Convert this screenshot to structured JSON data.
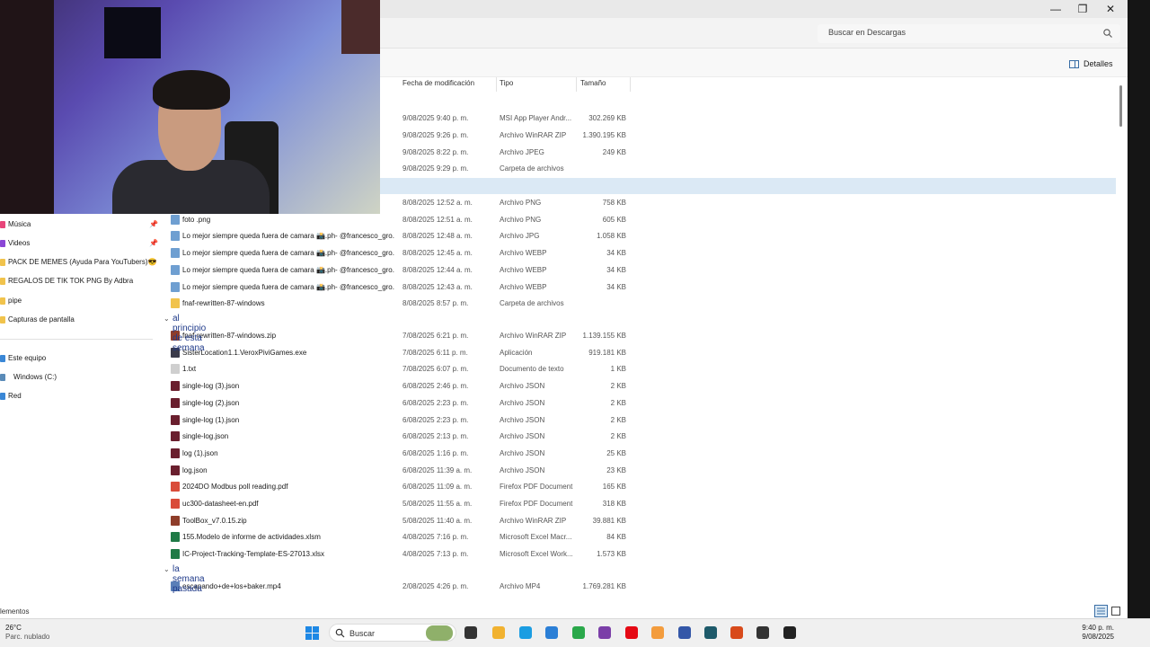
{
  "window": {
    "minimize": "—",
    "maximize": "❐",
    "close": "✕"
  },
  "search": {
    "placeholder": "Buscar en Descargas"
  },
  "toolbar": {
    "details_label": "Detalles"
  },
  "columns": {
    "date": "Fecha de modificación",
    "type": "Tipo",
    "size": "Tamaño"
  },
  "sidebar": {
    "items": [
      {
        "label": "Música",
        "pinned": true,
        "icon": "music-icon"
      },
      {
        "label": "Videos",
        "pinned": true,
        "icon": "video-icon"
      },
      {
        "label": "PACK DE MEMES (Ayuda Para YouTubers)😎",
        "pinned": false,
        "icon": "folder-icon"
      },
      {
        "label": "REGALOS DE TIK TOK PNG By Adbra",
        "pinned": false,
        "icon": "folder-icon"
      },
      {
        "label": "pipe",
        "pinned": false,
        "icon": "folder-icon"
      },
      {
        "label": "Capturas de pantalla",
        "pinned": false,
        "icon": "folder-icon"
      }
    ],
    "locations": [
      {
        "label": "Este equipo",
        "icon": "computer-icon"
      },
      {
        "label": "Windows (C:)",
        "icon": "drive-icon"
      },
      {
        "label": "Red",
        "icon": "network-icon"
      }
    ]
  },
  "files_top": [
    {
      "name": "",
      "date": "9/08/2025 9:40 p. m.",
      "type": "MSI App Player Andr...",
      "size": "302.269 KB"
    },
    {
      "name": "",
      "date": "9/08/2025 9:26 p. m.",
      "type": "Archivo WinRAR ZIP",
      "size": "1.390.195 KB"
    },
    {
      "name": "",
      "date": "9/08/2025 8:22 p. m.",
      "type": "Archivo JPEG",
      "size": "249 KB"
    },
    {
      "name": "",
      "date": "9/08/2025 9:29 p. m.",
      "type": "Carpeta de archivos",
      "size": ""
    },
    {
      "name": "",
      "date": "",
      "type": "",
      "size": ""
    },
    {
      "name": "",
      "date": "8/08/2025 12:52 a. m.",
      "type": "Archivo PNG",
      "size": "758 KB"
    },
    {
      "name": "foto .png",
      "date": "8/08/2025 12:51 a. m.",
      "type": "Archivo PNG",
      "size": "605 KB"
    },
    {
      "name": "Lo mejor siempre queda fuera de camara 📸.ph- @francesco_gro...",
      "date": "8/08/2025 12:48 a. m.",
      "type": "Archivo JPG",
      "size": "1.058 KB"
    },
    {
      "name": "Lo mejor siempre queda fuera de camara 📸.ph- @francesco_gro...",
      "date": "8/08/2025 12:45 a. m.",
      "type": "Archivo WEBP",
      "size": "34 KB"
    },
    {
      "name": "Lo mejor siempre queda fuera de camara 📸.ph- @francesco_gro...",
      "date": "8/08/2025 12:44 a. m.",
      "type": "Archivo WEBP",
      "size": "34 KB"
    },
    {
      "name": "Lo mejor siempre queda fuera de camara 📸.ph- @francesco_gro...",
      "date": "8/08/2025 12:43 a. m.",
      "type": "Archivo WEBP",
      "size": "34 KB"
    },
    {
      "name": "fnaf-rewritten-87-windows",
      "date": "8/08/2025 8:57 p. m.",
      "type": "Carpeta de archivos",
      "size": ""
    }
  ],
  "group_week": "al principio de esta semana",
  "files_week": [
    {
      "name": "fnaf-rewritten-87-windows.zip",
      "date": "7/08/2025 6:21 p. m.",
      "type": "Archivo WinRAR ZIP",
      "size": "1.139.155 KB"
    },
    {
      "name": "SisterLocation1.1.VeroxPiviGames.exe",
      "date": "7/08/2025 6:11 p. m.",
      "type": "Aplicación",
      "size": "919.181 KB"
    },
    {
      "name": "1.txt",
      "date": "7/08/2025 6:07 p. m.",
      "type": "Documento de texto",
      "size": "1 KB"
    },
    {
      "name": "single-log (3).json",
      "date": "6/08/2025 2:46 p. m.",
      "type": "Archivo JSON",
      "size": "2 KB"
    },
    {
      "name": "single-log (2).json",
      "date": "6/08/2025 2:23 p. m.",
      "type": "Archivo JSON",
      "size": "2 KB"
    },
    {
      "name": "single-log (1).json",
      "date": "6/08/2025 2:23 p. m.",
      "type": "Archivo JSON",
      "size": "2 KB"
    },
    {
      "name": "single-log.json",
      "date": "6/08/2025 2:13 p. m.",
      "type": "Archivo JSON",
      "size": "2 KB"
    },
    {
      "name": "log (1).json",
      "date": "6/08/2025 1:16 p. m.",
      "type": "Archivo JSON",
      "size": "25 KB"
    },
    {
      "name": "log.json",
      "date": "6/08/2025 11:39 a. m.",
      "type": "Archivo JSON",
      "size": "23 KB"
    },
    {
      "name": "2024DO Modbus poll reading.pdf",
      "date": "6/08/2025 11:09 a. m.",
      "type": "Firefox PDF Document",
      "size": "165 KB"
    },
    {
      "name": "uc300-datasheet-en.pdf",
      "date": "5/08/2025 11:55 a. m.",
      "type": "Firefox PDF Document",
      "size": "318 KB"
    },
    {
      "name": "ToolBox_v7.0.15.zip",
      "date": "5/08/2025 11:40 a. m.",
      "type": "Archivo WinRAR ZIP",
      "size": "39.881 KB"
    },
    {
      "name": "155.Modelo de informe de actividades.xlsm",
      "date": "4/08/2025 7:16 p. m.",
      "type": "Microsoft Excel Macr...",
      "size": "84 KB"
    },
    {
      "name": "IC-Project-Tracking-Template-ES-27013.xlsx",
      "date": "4/08/2025 7:13 p. m.",
      "type": "Microsoft Excel Work...",
      "size": "1.573 KB"
    }
  ],
  "group_last_week": "la semana pasada",
  "files_last_week": [
    {
      "name": "escapando+de+los+baker.mp4",
      "date": "2/08/2025 4:26 p. m.",
      "type": "Archivo MP4",
      "size": "1.769.281 KB"
    }
  ],
  "status": {
    "items_label": "lementos"
  },
  "taskbar": {
    "temp": "26°C",
    "weather": "Parc. nublado",
    "search_placeholder": "Buscar",
    "time": "9:40 p. m.",
    "date": "9/08/2025"
  }
}
